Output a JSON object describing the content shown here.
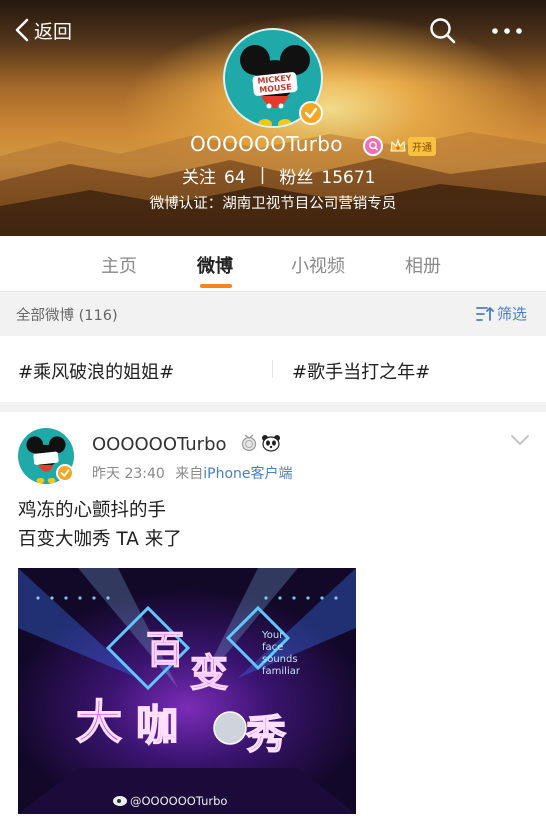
{
  "nav": {
    "back_label": "返回"
  },
  "profile": {
    "username": "OOOOOOTurbo",
    "vip_label": "开通",
    "following_label": "关注",
    "following_count": "64",
    "stats_separator": "|",
    "followers_label": "粉丝",
    "followers_count": "15671",
    "verification": "微博认证：湖南卫视节目公司营销专员",
    "avatar_text": [
      "MICKEY",
      "MOUSE"
    ]
  },
  "tabs": [
    {
      "label": "主页",
      "active": false
    },
    {
      "label": "微博",
      "active": true
    },
    {
      "label": "小视频",
      "active": false
    },
    {
      "label": "相册",
      "active": false
    }
  ],
  "filter_bar": {
    "all_label": "全部微博 (116)",
    "filter_label": "筛选"
  },
  "topics": [
    "#乘风破浪的姐姐#",
    "#歌手当打之年#"
  ],
  "post": {
    "username": "OOOOOOTurbo",
    "time": "昨天 23:40",
    "source_prefix": "来自",
    "source": "iPhone客户端",
    "text_lines": [
      "鸡冻的心颤抖的手",
      "百变大咖秀 TA 来了"
    ],
    "image": {
      "title_chars": [
        "百",
        "变",
        "大",
        "咖",
        "秀"
      ],
      "side_text": [
        "Your",
        "face",
        "sounds",
        "familiar"
      ],
      "watermark": "@OOOOOOTurbo"
    }
  },
  "colors": {
    "accent_orange": "#f4841f",
    "link_blue": "#4a7fc1",
    "verified_gold": "#f5a623",
    "avatar_teal": "#1fa9a8"
  },
  "icons": [
    "back-chevron-icon",
    "search-icon",
    "more-icon",
    "verified-icon",
    "membership-icon",
    "crown-icon",
    "filter-icon",
    "medal-icon",
    "panda-icon",
    "chevron-down-icon",
    "weibo-logo-icon"
  ]
}
